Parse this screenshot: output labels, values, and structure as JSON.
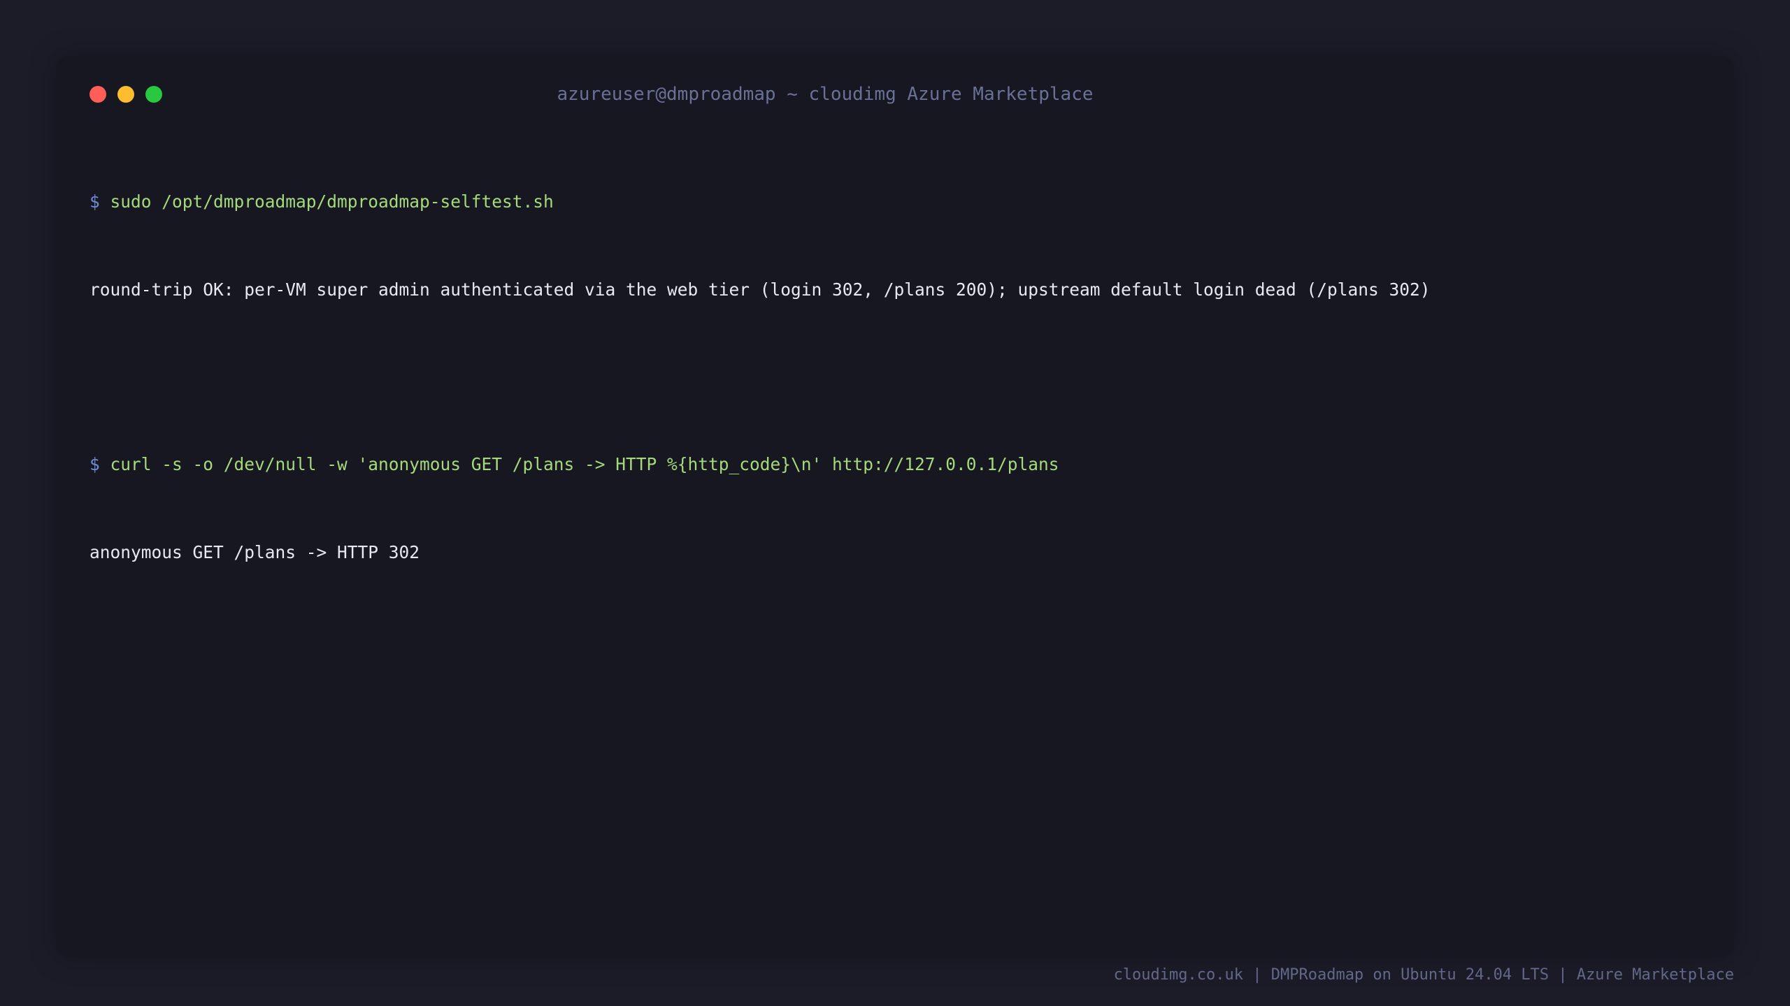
{
  "window": {
    "title": "azureuser@dmproadmap ~ cloudimg Azure Marketplace",
    "controls": {
      "close_color": "#ff5f57",
      "minimize_color": "#febc2e",
      "maximize_color": "#28c840"
    }
  },
  "terminal": {
    "prompt_symbol": "$",
    "lines": [
      {
        "type": "command",
        "text": "sudo /opt/dmproadmap/dmproadmap-selftest.sh"
      },
      {
        "type": "output",
        "text": "round-trip OK: per-VM super admin authenticated via the web tier (login 302, /plans 200); upstream default login dead (/plans 302)"
      },
      {
        "type": "blank",
        "text": ""
      },
      {
        "type": "command",
        "text": "curl -s -o /dev/null -w 'anonymous GET /plans -> HTTP %{http_code}\\n' http://127.0.0.1/plans"
      },
      {
        "type": "output",
        "text": "anonymous GET /plans -> HTTP 302"
      }
    ]
  },
  "footer": {
    "text": "cloudimg.co.uk | DMPRoadmap on Ubuntu 24.04 LTS | Azure Marketplace"
  },
  "colors": {
    "background": "#1b1c28",
    "window_background": "#161721",
    "prompt": "#6f8bd4",
    "command": "#a6d97a",
    "output": "#e6e8f2",
    "title": "#6b7096"
  }
}
